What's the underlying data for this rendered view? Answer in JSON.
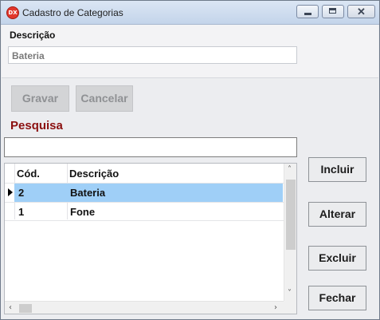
{
  "window": {
    "title": "Cadastro de Categorias",
    "app_icon_text": "DX"
  },
  "form": {
    "description_label": "Descrição",
    "description_value": "Bateria"
  },
  "actions": {
    "save_label": "Gravar",
    "cancel_label": "Cancelar"
  },
  "search": {
    "label": "Pesquisa",
    "value": ""
  },
  "grid": {
    "columns": [
      "Cód.",
      "Descrição"
    ],
    "rows": [
      {
        "cod": "2",
        "desc": "Bateria",
        "selected": true
      },
      {
        "cod": "1",
        "desc": "Fone",
        "selected": false
      }
    ]
  },
  "side_buttons": {
    "include_label": "Incluir",
    "edit_label": "Alterar",
    "delete_label": "Excluir",
    "close_label": "Fechar"
  },
  "colors": {
    "selection": "#9fcff7",
    "search_label": "#8b1010",
    "app_icon": "#e2362b"
  }
}
